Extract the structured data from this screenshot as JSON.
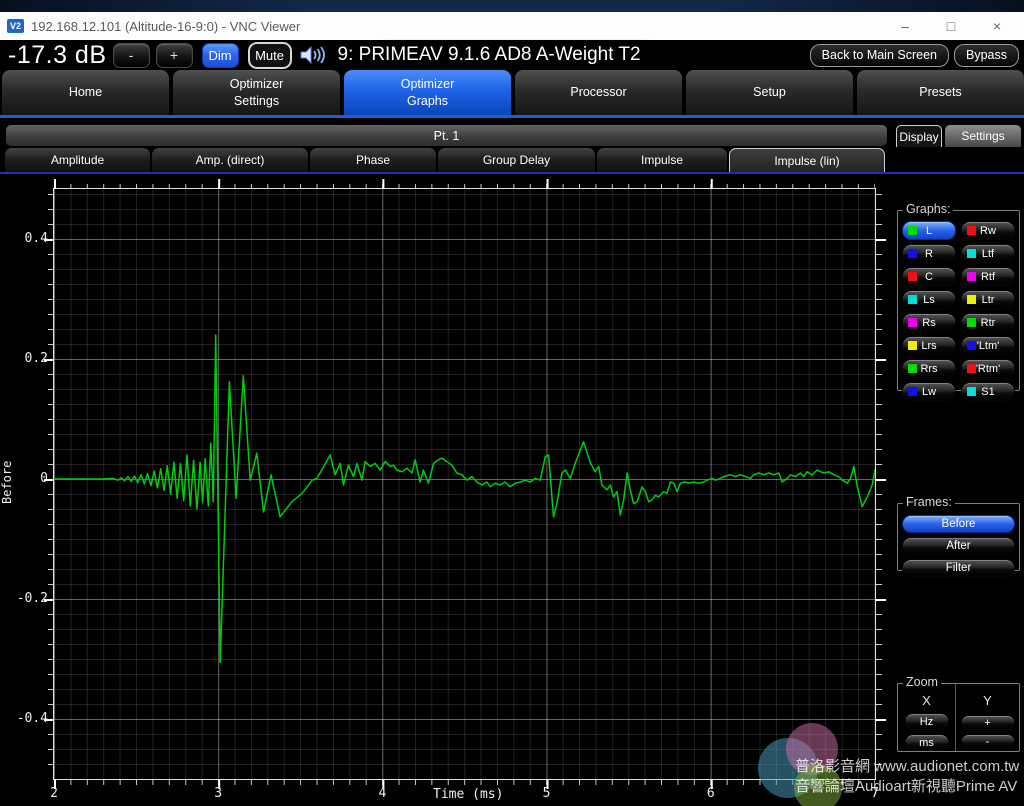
{
  "window": {
    "title": "192.168.12.101 (Altitude-16-9:0) - VNC Viewer",
    "icon_text": "V2",
    "controls": [
      {
        "name": "minimize-button",
        "glyph": "–"
      },
      {
        "name": "maximize-button",
        "glyph": "□"
      },
      {
        "name": "close-button",
        "glyph": "×"
      }
    ]
  },
  "topbar": {
    "volume": "-17.3 dB",
    "minus": "-",
    "plus": "+",
    "dim": "Dim",
    "mute": "Mute",
    "speaker_icon": "speaker-volume-icon",
    "preset_title": "9: PRIMEAV 9.1.6 AD8 A-Weight T2",
    "back": "Back to Main Screen",
    "bypass": "Bypass"
  },
  "main_tabs": [
    {
      "label": "Home",
      "active": false
    },
    {
      "label": "Optimizer\nSettings",
      "active": false
    },
    {
      "label": "Optimizer\nGraphs",
      "active": true
    },
    {
      "label": "Processor",
      "active": false
    },
    {
      "label": "Setup",
      "active": false
    },
    {
      "label": "Presets",
      "active": false
    }
  ],
  "pt_bar": "Pt. 1",
  "side_tabs": {
    "display": "Display",
    "settings": "Settings"
  },
  "graph_tabs": [
    {
      "label": "Amplitude",
      "active": false
    },
    {
      "label": "Amp. (direct)",
      "active": false
    },
    {
      "label": "Phase",
      "active": false
    },
    {
      "label": "Group Delay",
      "active": false
    },
    {
      "label": "Impulse",
      "active": false
    },
    {
      "label": "Impulse (lin)",
      "active": true
    }
  ],
  "sidebar": {
    "graphs_label": "Graphs:",
    "channels": [
      {
        "label": "L",
        "color": "#00dd00",
        "active": true
      },
      {
        "label": "Rw",
        "color": "#ee1111",
        "active": false
      },
      {
        "label": "R",
        "color": "#1111ee",
        "active": false
      },
      {
        "label": "Ltf",
        "color": "#00dddd",
        "active": false
      },
      {
        "label": "C",
        "color": "#ee1111",
        "active": false
      },
      {
        "label": "Rtf",
        "color": "#ee00ee",
        "active": false
      },
      {
        "label": "Ls",
        "color": "#00dddd",
        "active": false
      },
      {
        "label": "Ltr",
        "color": "#eeee00",
        "active": false
      },
      {
        "label": "Rs",
        "color": "#ee00ee",
        "active": false
      },
      {
        "label": "Rtr",
        "color": "#00dd00",
        "active": false
      },
      {
        "label": "Lrs",
        "color": "#eeee00",
        "active": false
      },
      {
        "label": "'Ltm'",
        "color": "#1111ee",
        "active": false
      },
      {
        "label": "Rrs",
        "color": "#00dd00",
        "active": false
      },
      {
        "label": "'Rtm'",
        "color": "#ee1111",
        "active": false
      },
      {
        "label": "Lw",
        "color": "#1111ee",
        "active": false
      },
      {
        "label": "S1",
        "color": "#00dddd",
        "active": false
      }
    ],
    "frames_label": "Frames:",
    "frames": [
      {
        "label": "Before",
        "active": true
      },
      {
        "label": "After",
        "active": false
      },
      {
        "label": "Filter",
        "active": false
      }
    ],
    "zoom_label": "Zoom",
    "zoom": {
      "x_label": "X",
      "y_label": "Y",
      "x_buttons": [
        "Hz",
        "ms"
      ],
      "y_buttons": [
        "+",
        "-"
      ]
    }
  },
  "chart_data": {
    "type": "line",
    "title": "",
    "xlabel": "Time (ms)",
    "ylabel": "Before",
    "xlim": [
      2,
      7
    ],
    "ylim": [
      -0.5,
      0.5
    ],
    "grid": true,
    "x_tick_labels": [
      "2",
      "3",
      "4",
      "5",
      "6",
      "7"
    ],
    "y_tick_labels": [
      "0.4",
      "0.2",
      "0",
      "-0.2",
      "-0.4"
    ],
    "series": [
      {
        "name": "L impulse response (Before)",
        "color": "#00cc10",
        "points": [
          [
            2.0,
            0
          ],
          [
            2.15,
            0
          ],
          [
            2.3,
            0
          ],
          [
            2.36,
            0.001
          ],
          [
            2.39,
            -0.002
          ],
          [
            2.41,
            0.002
          ],
          [
            2.43,
            -0.003
          ],
          [
            2.45,
            0.004
          ],
          [
            2.47,
            -0.004
          ],
          [
            2.49,
            0.005
          ],
          [
            2.51,
            -0.006
          ],
          [
            2.53,
            0.007
          ],
          [
            2.55,
            -0.008
          ],
          [
            2.57,
            0.009
          ],
          [
            2.59,
            -0.011
          ],
          [
            2.61,
            0.013
          ],
          [
            2.63,
            -0.015
          ],
          [
            2.65,
            0.017
          ],
          [
            2.67,
            -0.019
          ],
          [
            2.69,
            0.022
          ],
          [
            2.71,
            -0.025
          ],
          [
            2.73,
            0.028
          ],
          [
            2.75,
            -0.032
          ],
          [
            2.77,
            0.026
          ],
          [
            2.79,
            -0.036
          ],
          [
            2.81,
            0.04
          ],
          [
            2.83,
            -0.045
          ],
          [
            2.85,
            0.031
          ],
          [
            2.87,
            -0.05
          ],
          [
            2.89,
            0.028
          ],
          [
            2.905,
            -0.04
          ],
          [
            2.92,
            0.034
          ],
          [
            2.94,
            -0.045
          ],
          [
            2.955,
            0.06
          ],
          [
            2.97,
            -0.038
          ],
          [
            2.985,
            0.24
          ],
          [
            3.012,
            -0.306
          ],
          [
            3.068,
            0.162
          ],
          [
            3.109,
            -0.032
          ],
          [
            3.153,
            0.172
          ],
          [
            3.195,
            -0.002
          ],
          [
            3.235,
            0.043
          ],
          [
            3.276,
            -0.055
          ],
          [
            3.322,
            0.007
          ],
          [
            3.377,
            -0.063
          ],
          [
            3.448,
            -0.038
          ],
          [
            3.511,
            -0.024
          ],
          [
            3.572,
            -0.002
          ],
          [
            3.601,
            0.001
          ],
          [
            3.631,
            0.015
          ],
          [
            3.682,
            0.04
          ],
          [
            3.712,
            0.007
          ],
          [
            3.743,
            0.026
          ],
          [
            3.763,
            -0.01
          ],
          [
            3.793,
            0.023
          ],
          [
            3.824,
            0.004
          ],
          [
            3.845,
            0.026
          ],
          [
            3.875,
            -0.002
          ],
          [
            3.895,
            0.029
          ],
          [
            3.926,
            0.021
          ],
          [
            3.956,
            0.026
          ],
          [
            3.986,
            0.015
          ],
          [
            4.017,
            0.029
          ],
          [
            4.048,
            0.021
          ],
          [
            4.068,
            0.023
          ],
          [
            4.088,
            0.015
          ],
          [
            4.119,
            0.012
          ],
          [
            4.149,
            0.018
          ],
          [
            4.18,
            0.01
          ],
          [
            4.2,
            0.032
          ],
          [
            4.23,
            -0.005
          ],
          [
            4.25,
            0.015
          ],
          [
            4.281,
            -0.007
          ],
          [
            4.311,
            0.026
          ],
          [
            4.342,
            0.032
          ],
          [
            4.362,
            0.035
          ],
          [
            4.393,
            0.029
          ],
          [
            4.423,
            0.023
          ],
          [
            4.454,
            0.01
          ],
          [
            4.484,
            0.007
          ],
          [
            4.515,
            -0.002
          ],
          [
            4.545,
            0.004
          ],
          [
            4.575,
            -0.005
          ],
          [
            4.606,
            -0.01
          ],
          [
            4.636,
            -0.005
          ],
          [
            4.657,
            -0.013
          ],
          [
            4.687,
            -0.007
          ],
          [
            4.717,
            -0.01
          ],
          [
            4.748,
            -0.005
          ],
          [
            4.778,
            -0.013
          ],
          [
            4.809,
            -0.007
          ],
          [
            4.839,
            -0.005
          ],
          [
            4.87,
            -0.002
          ],
          [
            4.9,
            -0.005
          ],
          [
            4.931,
            0.001
          ],
          [
            4.961,
            -0.002
          ],
          [
            4.992,
            0.037
          ],
          [
            5.012,
            0.04
          ],
          [
            5.042,
            -0.063
          ],
          [
            5.063,
            -0.041
          ],
          [
            5.093,
            0.01
          ],
          [
            5.114,
            0.015
          ],
          [
            5.144,
            0.001
          ],
          [
            5.174,
            0.026
          ],
          [
            5.225,
            0.062
          ],
          [
            5.266,
            0.027
          ],
          [
            5.296,
            0.012
          ],
          [
            5.317,
            0.021
          ],
          [
            5.337,
            -0.01
          ],
          [
            5.368,
            -0.018
          ],
          [
            5.388,
            -0.01
          ],
          [
            5.408,
            -0.03
          ],
          [
            5.429,
            -0.021
          ],
          [
            5.449,
            -0.06
          ],
          [
            5.469,
            -0.035
          ],
          [
            5.49,
            0.01
          ],
          [
            5.51,
            -0.018
          ],
          [
            5.53,
            -0.041
          ],
          [
            5.551,
            -0.038
          ],
          [
            5.581,
            -0.013
          ],
          [
            5.601,
            -0.021
          ],
          [
            5.622,
            -0.038
          ],
          [
            5.642,
            -0.035
          ],
          [
            5.662,
            -0.027
          ],
          [
            5.682,
            -0.03
          ],
          [
            5.713,
            -0.021
          ],
          [
            5.733,
            -0.024
          ],
          [
            5.754,
            -0.005
          ],
          [
            5.774,
            -0.007
          ],
          [
            5.794,
            -0.021
          ],
          [
            5.815,
            -0.007
          ],
          [
            5.845,
            -0.005
          ],
          [
            5.865,
            -0.007
          ],
          [
            5.896,
            -0.005
          ],
          [
            5.926,
            -0.007
          ],
          [
            5.957,
            -0.005
          ],
          [
            5.977,
            -0.002
          ],
          [
            6.008,
            0.001
          ],
          [
            6.028,
            -0.002
          ],
          [
            6.058,
            0.001
          ],
          [
            6.079,
            0.004
          ],
          [
            6.119,
            0.007
          ],
          [
            6.15,
            0.004
          ],
          [
            6.18,
            0.007
          ],
          [
            6.211,
            0.004
          ],
          [
            6.241,
            0.001
          ],
          [
            6.261,
            0.007
          ],
          [
            6.292,
            0.01
          ],
          [
            6.322,
            0.007
          ],
          [
            6.353,
            0.01
          ],
          [
            6.383,
            0.007
          ],
          [
            6.414,
            0.01
          ],
          [
            6.434,
            -0.005
          ],
          [
            6.465,
            0.001
          ],
          [
            6.485,
            0.007
          ],
          [
            6.515,
            0.004
          ],
          [
            6.546,
            0.01
          ],
          [
            6.566,
            0.004
          ],
          [
            6.587,
            0.012
          ],
          [
            6.617,
            0.007
          ],
          [
            6.648,
            0.015
          ],
          [
            6.668,
            0.012
          ],
          [
            6.688,
            0.01
          ],
          [
            6.719,
            0.012
          ],
          [
            6.749,
            0.007
          ],
          [
            6.78,
            0.004
          ],
          [
            6.8,
            -0.002
          ],
          [
            6.831,
            -0.007
          ],
          [
            6.851,
            0.001
          ],
          [
            6.871,
            0.021
          ],
          [
            6.892,
            -0.013
          ],
          [
            6.922,
            -0.046
          ],
          [
            6.953,
            -0.03
          ],
          [
            6.983,
            -0.01
          ],
          [
            7.0,
            0.015
          ]
        ]
      }
    ]
  },
  "watermark": {
    "line1": "普洛影音網 www.audionet.com.tw",
    "line2": "音響論壇Audioart新視聽Prime AV"
  }
}
